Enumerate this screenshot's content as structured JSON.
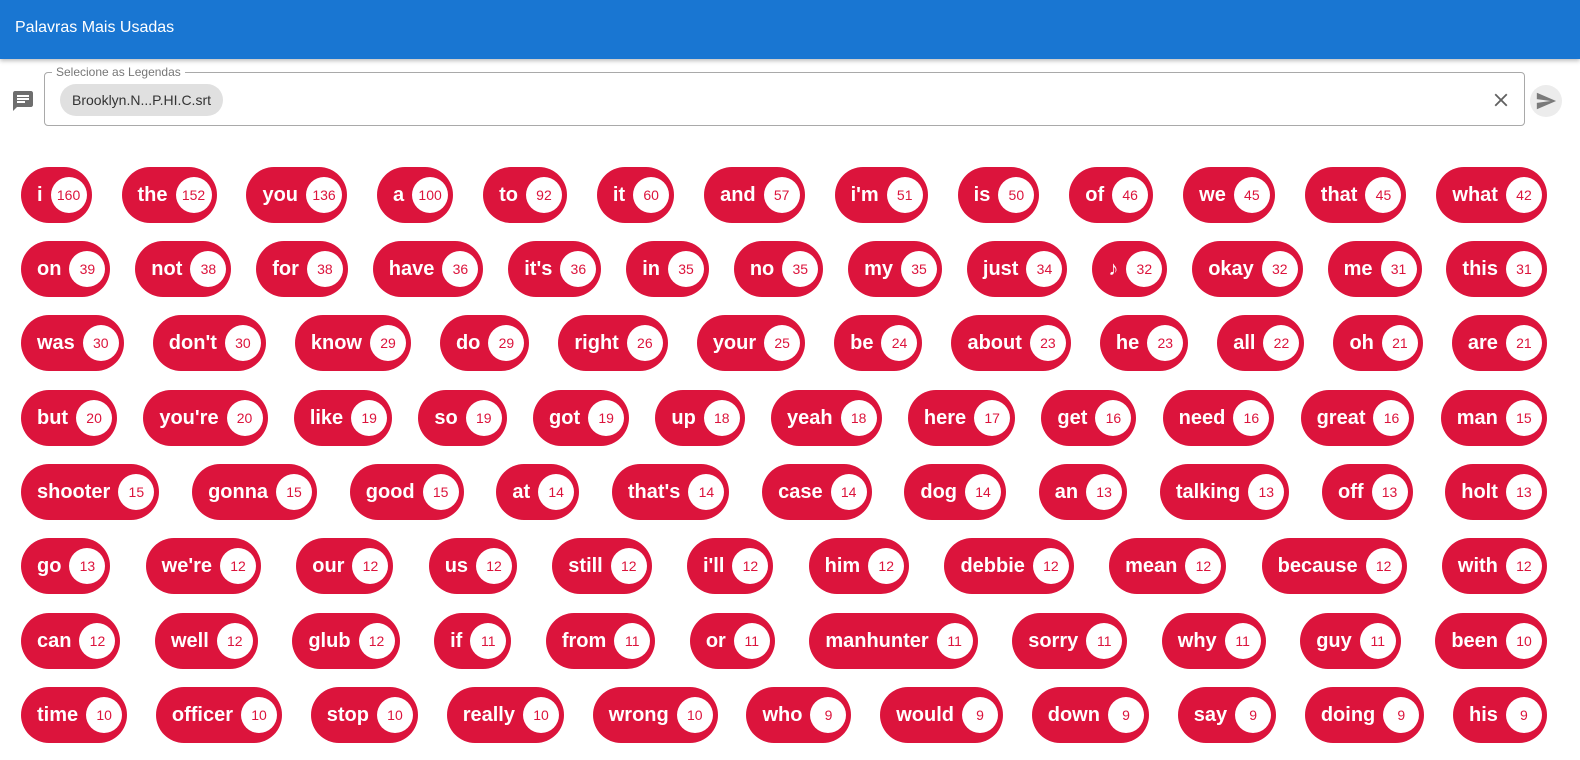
{
  "app": {
    "title": "Palavras Mais Usadas"
  },
  "search": {
    "legend": "Selecione as Legendas",
    "chip_label": "Brooklyn.N...P.HI.C.srt"
  },
  "icons": {
    "subtitles": "message-icon",
    "clear": "close-icon",
    "send": "send-icon"
  },
  "colors": {
    "appbar": "#1976d2",
    "pill": "#dc143c",
    "badge_bg": "#ffffff",
    "chip": "#e0e0e0"
  },
  "word_rows": [
    [
      {
        "word": "i",
        "count": 160
      },
      {
        "word": "the",
        "count": 152
      },
      {
        "word": "you",
        "count": 136
      },
      {
        "word": "a",
        "count": 100
      },
      {
        "word": "to",
        "count": 92
      },
      {
        "word": "it",
        "count": 60
      },
      {
        "word": "and",
        "count": 57
      },
      {
        "word": "i'm",
        "count": 51
      },
      {
        "word": "is",
        "count": 50
      },
      {
        "word": "of",
        "count": 46
      },
      {
        "word": "we",
        "count": 45
      },
      {
        "word": "that",
        "count": 45
      },
      {
        "word": "what",
        "count": 42
      }
    ],
    [
      {
        "word": "on",
        "count": 39
      },
      {
        "word": "not",
        "count": 38
      },
      {
        "word": "for",
        "count": 38
      },
      {
        "word": "have",
        "count": 36
      },
      {
        "word": "it's",
        "count": 36
      },
      {
        "word": "in",
        "count": 35
      },
      {
        "word": "no",
        "count": 35
      },
      {
        "word": "my",
        "count": 35
      },
      {
        "word": "just",
        "count": 34
      },
      {
        "word": "♪",
        "count": 32
      },
      {
        "word": "okay",
        "count": 32
      },
      {
        "word": "me",
        "count": 31
      },
      {
        "word": "this",
        "count": 31
      }
    ],
    [
      {
        "word": "was",
        "count": 30
      },
      {
        "word": "don't",
        "count": 30
      },
      {
        "word": "know",
        "count": 29
      },
      {
        "word": "do",
        "count": 29
      },
      {
        "word": "right",
        "count": 26
      },
      {
        "word": "your",
        "count": 25
      },
      {
        "word": "be",
        "count": 24
      },
      {
        "word": "about",
        "count": 23
      },
      {
        "word": "he",
        "count": 23
      },
      {
        "word": "all",
        "count": 22
      },
      {
        "word": "oh",
        "count": 21
      },
      {
        "word": "are",
        "count": 21
      }
    ],
    [
      {
        "word": "but",
        "count": 20
      },
      {
        "word": "you're",
        "count": 20
      },
      {
        "word": "like",
        "count": 19
      },
      {
        "word": "so",
        "count": 19
      },
      {
        "word": "got",
        "count": 19
      },
      {
        "word": "up",
        "count": 18
      },
      {
        "word": "yeah",
        "count": 18
      },
      {
        "word": "here",
        "count": 17
      },
      {
        "word": "get",
        "count": 16
      },
      {
        "word": "need",
        "count": 16
      },
      {
        "word": "great",
        "count": 16
      },
      {
        "word": "man",
        "count": 15
      }
    ],
    [
      {
        "word": "shooter",
        "count": 15
      },
      {
        "word": "gonna",
        "count": 15
      },
      {
        "word": "good",
        "count": 15
      },
      {
        "word": "at",
        "count": 14
      },
      {
        "word": "that's",
        "count": 14
      },
      {
        "word": "case",
        "count": 14
      },
      {
        "word": "dog",
        "count": 14
      },
      {
        "word": "an",
        "count": 13
      },
      {
        "word": "talking",
        "count": 13
      },
      {
        "word": "off",
        "count": 13
      },
      {
        "word": "holt",
        "count": 13
      }
    ],
    [
      {
        "word": "go",
        "count": 13
      },
      {
        "word": "we're",
        "count": 12
      },
      {
        "word": "our",
        "count": 12
      },
      {
        "word": "us",
        "count": 12
      },
      {
        "word": "still",
        "count": 12
      },
      {
        "word": "i'll",
        "count": 12
      },
      {
        "word": "him",
        "count": 12
      },
      {
        "word": "debbie",
        "count": 12
      },
      {
        "word": "mean",
        "count": 12
      },
      {
        "word": "because",
        "count": 12
      },
      {
        "word": "with",
        "count": 12
      }
    ],
    [
      {
        "word": "can",
        "count": 12
      },
      {
        "word": "well",
        "count": 12
      },
      {
        "word": "glub",
        "count": 12
      },
      {
        "word": "if",
        "count": 11
      },
      {
        "word": "from",
        "count": 11
      },
      {
        "word": "or",
        "count": 11
      },
      {
        "word": "manhunter",
        "count": 11
      },
      {
        "word": "sorry",
        "count": 11
      },
      {
        "word": "why",
        "count": 11
      },
      {
        "word": "guy",
        "count": 11
      },
      {
        "word": "been",
        "count": 10
      }
    ],
    [
      {
        "word": "time",
        "count": 10
      },
      {
        "word": "officer",
        "count": 10
      },
      {
        "word": "stop",
        "count": 10
      },
      {
        "word": "really",
        "count": 10
      },
      {
        "word": "wrong",
        "count": 10
      },
      {
        "word": "who",
        "count": 9
      },
      {
        "word": "would",
        "count": 9
      },
      {
        "word": "down",
        "count": 9
      },
      {
        "word": "say",
        "count": 9
      },
      {
        "word": "doing",
        "count": 9
      },
      {
        "word": "his",
        "count": 9
      }
    ]
  ]
}
